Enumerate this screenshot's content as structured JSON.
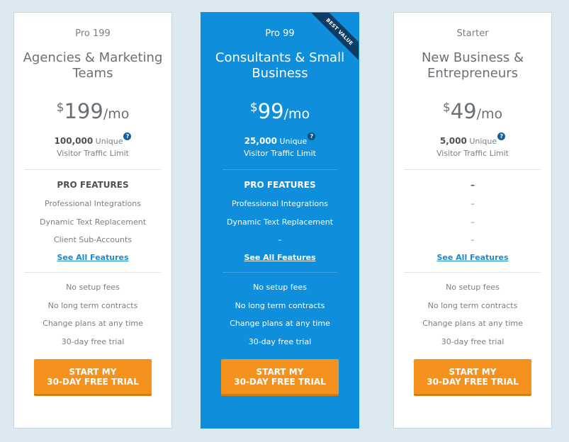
{
  "plans": [
    {
      "name": "Pro 199",
      "audience": "Agencies & Marketing Teams",
      "currency": "$",
      "amount": "199",
      "per": "/mo",
      "visitors": "100,000",
      "unique": "Unique",
      "help": "?",
      "visitors_label": "Visitor Traffic Limit",
      "features_title": "PRO FEATURES",
      "features": [
        "Professional Integrations",
        "Dynamic Text Replacement",
        "Client Sub-Accounts"
      ],
      "see_all": "See All Features",
      "perks": [
        "No setup fees",
        "No long term contracts",
        "Change plans at any time",
        "30-day free trial"
      ],
      "cta_line1": "START MY",
      "cta_line2": "30-DAY FREE TRIAL"
    },
    {
      "name": "Pro 99",
      "audience": "Consultants & Small Business",
      "currency": "$",
      "amount": "99",
      "per": "/mo",
      "visitors": "25,000",
      "unique": "Unique",
      "help": "?",
      "visitors_label": "Visitor Traffic Limit",
      "features_title": "PRO FEATURES",
      "features": [
        "Professional Integrations",
        "Dynamic Text Replacement",
        "–"
      ],
      "see_all": "See All Features",
      "perks": [
        "No setup fees",
        "No long term contracts",
        "Change plans at any time",
        "30-day free trial"
      ],
      "cta_line1": "START MY",
      "cta_line2": "30-DAY FREE TRIAL",
      "ribbon": "BEST VALUE"
    },
    {
      "name": "Starter",
      "audience": "New Business & Entrepreneurs",
      "currency": "$",
      "amount": "49",
      "per": "/mo",
      "visitors": "5,000",
      "unique": "Unique",
      "help": "?",
      "visitors_label": "Visitor Traffic Limit",
      "features_title": "–",
      "features": [
        "–",
        "–",
        "–"
      ],
      "see_all": "See All Features",
      "perks": [
        "No setup fees",
        "No long term contracts",
        "Change plans at any time",
        "30-day free trial"
      ],
      "cta_line1": "START MY",
      "cta_line2": "30-DAY FREE TRIAL"
    }
  ],
  "colors": {
    "background": "#dde9f1",
    "featured": "#0f8fdb",
    "cta": "#f5921e",
    "link": "#1a8ad4",
    "ribbon": "#0b3d66"
  }
}
